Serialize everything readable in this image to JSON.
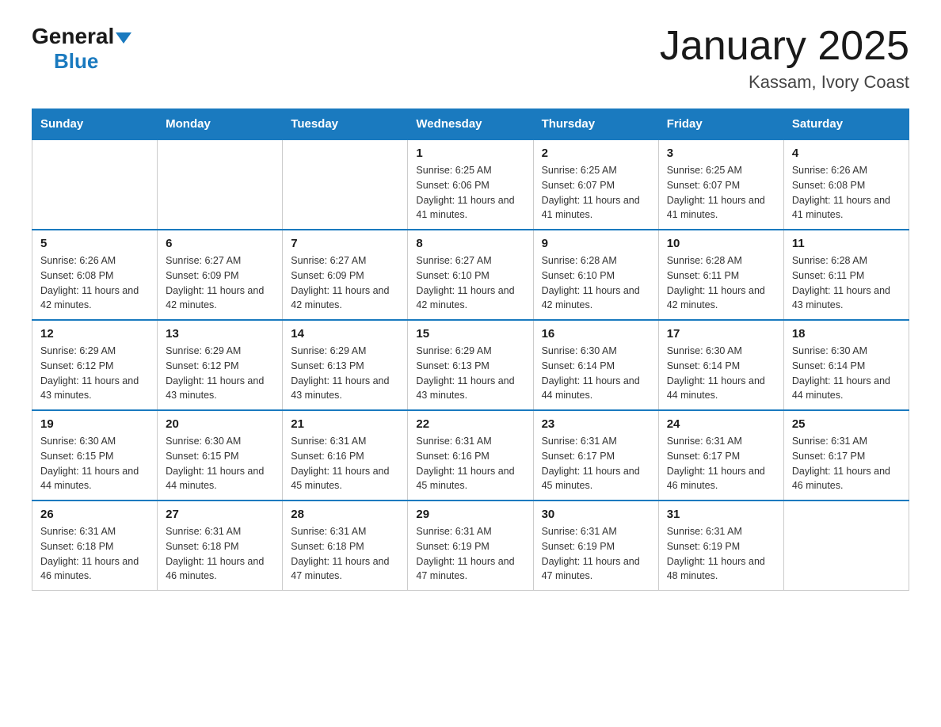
{
  "logo": {
    "general": "General",
    "blue": "Blue"
  },
  "title": "January 2025",
  "subtitle": "Kassam, Ivory Coast",
  "days_of_week": [
    "Sunday",
    "Monday",
    "Tuesday",
    "Wednesday",
    "Thursday",
    "Friday",
    "Saturday"
  ],
  "weeks": [
    [
      {
        "day": "",
        "info": ""
      },
      {
        "day": "",
        "info": ""
      },
      {
        "day": "",
        "info": ""
      },
      {
        "day": "1",
        "info": "Sunrise: 6:25 AM\nSunset: 6:06 PM\nDaylight: 11 hours and 41 minutes."
      },
      {
        "day": "2",
        "info": "Sunrise: 6:25 AM\nSunset: 6:07 PM\nDaylight: 11 hours and 41 minutes."
      },
      {
        "day": "3",
        "info": "Sunrise: 6:25 AM\nSunset: 6:07 PM\nDaylight: 11 hours and 41 minutes."
      },
      {
        "day": "4",
        "info": "Sunrise: 6:26 AM\nSunset: 6:08 PM\nDaylight: 11 hours and 41 minutes."
      }
    ],
    [
      {
        "day": "5",
        "info": "Sunrise: 6:26 AM\nSunset: 6:08 PM\nDaylight: 11 hours and 42 minutes."
      },
      {
        "day": "6",
        "info": "Sunrise: 6:27 AM\nSunset: 6:09 PM\nDaylight: 11 hours and 42 minutes."
      },
      {
        "day": "7",
        "info": "Sunrise: 6:27 AM\nSunset: 6:09 PM\nDaylight: 11 hours and 42 minutes."
      },
      {
        "day": "8",
        "info": "Sunrise: 6:27 AM\nSunset: 6:10 PM\nDaylight: 11 hours and 42 minutes."
      },
      {
        "day": "9",
        "info": "Sunrise: 6:28 AM\nSunset: 6:10 PM\nDaylight: 11 hours and 42 minutes."
      },
      {
        "day": "10",
        "info": "Sunrise: 6:28 AM\nSunset: 6:11 PM\nDaylight: 11 hours and 42 minutes."
      },
      {
        "day": "11",
        "info": "Sunrise: 6:28 AM\nSunset: 6:11 PM\nDaylight: 11 hours and 43 minutes."
      }
    ],
    [
      {
        "day": "12",
        "info": "Sunrise: 6:29 AM\nSunset: 6:12 PM\nDaylight: 11 hours and 43 minutes."
      },
      {
        "day": "13",
        "info": "Sunrise: 6:29 AM\nSunset: 6:12 PM\nDaylight: 11 hours and 43 minutes."
      },
      {
        "day": "14",
        "info": "Sunrise: 6:29 AM\nSunset: 6:13 PM\nDaylight: 11 hours and 43 minutes."
      },
      {
        "day": "15",
        "info": "Sunrise: 6:29 AM\nSunset: 6:13 PM\nDaylight: 11 hours and 43 minutes."
      },
      {
        "day": "16",
        "info": "Sunrise: 6:30 AM\nSunset: 6:14 PM\nDaylight: 11 hours and 44 minutes."
      },
      {
        "day": "17",
        "info": "Sunrise: 6:30 AM\nSunset: 6:14 PM\nDaylight: 11 hours and 44 minutes."
      },
      {
        "day": "18",
        "info": "Sunrise: 6:30 AM\nSunset: 6:14 PM\nDaylight: 11 hours and 44 minutes."
      }
    ],
    [
      {
        "day": "19",
        "info": "Sunrise: 6:30 AM\nSunset: 6:15 PM\nDaylight: 11 hours and 44 minutes."
      },
      {
        "day": "20",
        "info": "Sunrise: 6:30 AM\nSunset: 6:15 PM\nDaylight: 11 hours and 44 minutes."
      },
      {
        "day": "21",
        "info": "Sunrise: 6:31 AM\nSunset: 6:16 PM\nDaylight: 11 hours and 45 minutes."
      },
      {
        "day": "22",
        "info": "Sunrise: 6:31 AM\nSunset: 6:16 PM\nDaylight: 11 hours and 45 minutes."
      },
      {
        "day": "23",
        "info": "Sunrise: 6:31 AM\nSunset: 6:17 PM\nDaylight: 11 hours and 45 minutes."
      },
      {
        "day": "24",
        "info": "Sunrise: 6:31 AM\nSunset: 6:17 PM\nDaylight: 11 hours and 46 minutes."
      },
      {
        "day": "25",
        "info": "Sunrise: 6:31 AM\nSunset: 6:17 PM\nDaylight: 11 hours and 46 minutes."
      }
    ],
    [
      {
        "day": "26",
        "info": "Sunrise: 6:31 AM\nSunset: 6:18 PM\nDaylight: 11 hours and 46 minutes."
      },
      {
        "day": "27",
        "info": "Sunrise: 6:31 AM\nSunset: 6:18 PM\nDaylight: 11 hours and 46 minutes."
      },
      {
        "day": "28",
        "info": "Sunrise: 6:31 AM\nSunset: 6:18 PM\nDaylight: 11 hours and 47 minutes."
      },
      {
        "day": "29",
        "info": "Sunrise: 6:31 AM\nSunset: 6:19 PM\nDaylight: 11 hours and 47 minutes."
      },
      {
        "day": "30",
        "info": "Sunrise: 6:31 AM\nSunset: 6:19 PM\nDaylight: 11 hours and 47 minutes."
      },
      {
        "day": "31",
        "info": "Sunrise: 6:31 AM\nSunset: 6:19 PM\nDaylight: 11 hours and 48 minutes."
      },
      {
        "day": "",
        "info": ""
      }
    ]
  ]
}
